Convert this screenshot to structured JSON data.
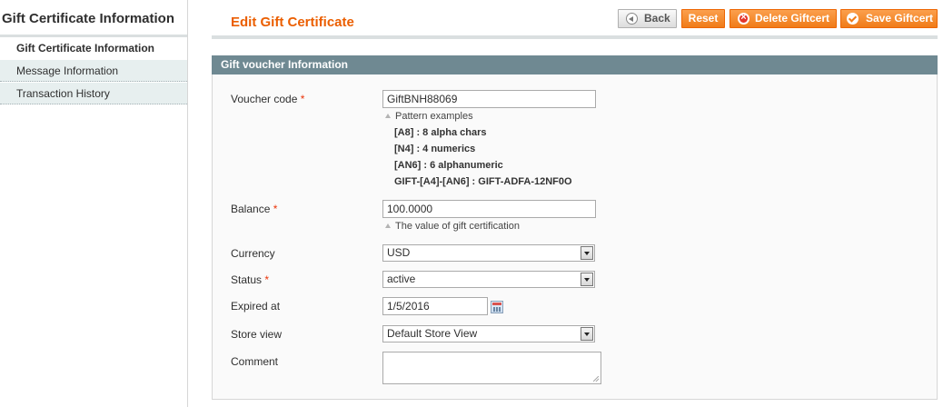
{
  "sidebar": {
    "title": "Gift Certificate Information",
    "items": [
      {
        "label": "Gift Certificate Information",
        "active": true
      },
      {
        "label": "Message Information",
        "active": false
      },
      {
        "label": "Transaction History",
        "active": false
      }
    ]
  },
  "header": {
    "title": "Edit Gift Certificate",
    "buttons": {
      "back": "Back",
      "reset": "Reset",
      "delete": "Delete Giftcert",
      "save": "Save Giftcert"
    }
  },
  "fieldset": {
    "legend": "Gift voucher Information",
    "voucher_code": {
      "label": "Voucher code",
      "required_mark": "*",
      "value": "GiftBNH88069",
      "note": "Pattern examples",
      "patterns": [
        "[A8] : 8 alpha chars",
        "[N4] : 4 numerics",
        "[AN6] : 6 alphanumeric",
        "GIFT-[A4]-[AN6] : GIFT-ADFA-12NF0O"
      ]
    },
    "balance": {
      "label": "Balance",
      "required_mark": "*",
      "value": "100.0000",
      "note": "The value of gift certification"
    },
    "currency": {
      "label": "Currency",
      "value": "USD"
    },
    "status": {
      "label": "Status",
      "required_mark": "*",
      "value": "active"
    },
    "expired_at": {
      "label": "Expired at",
      "value": "1/5/2016"
    },
    "store_view": {
      "label": "Store view",
      "value": "Default Store View"
    },
    "comment": {
      "label": "Comment",
      "value": ""
    }
  },
  "colors": {
    "accent": "#eb5e00",
    "button_orange": "#f07b18",
    "legend_bg": "#6f8992",
    "required": "#eb340a"
  }
}
